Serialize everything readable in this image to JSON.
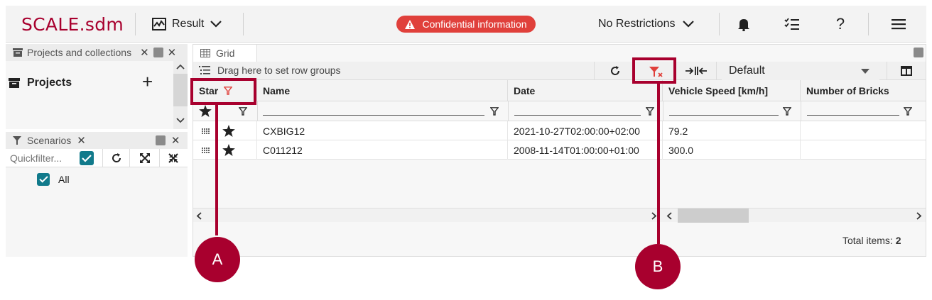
{
  "header": {
    "logo": "SCALE.sdm",
    "result_label": "Result",
    "confidential_label": "Confidential information",
    "restrictions_label": "No Restrictions"
  },
  "projects_panel": {
    "title": "Projects and collections",
    "heading": "Projects"
  },
  "scenarios_panel": {
    "title": "Scenarios",
    "quickfilter_placeholder": "Quickfilter...",
    "all_label": "All"
  },
  "grid": {
    "tab_label": "Grid",
    "row_group_hint": "Drag here to set row groups",
    "view_select": "Default",
    "columns": [
      "Star",
      "Name",
      "Date",
      "Vehicle Speed [km/h]",
      "Number of Bricks"
    ],
    "rows": [
      {
        "name": "CXBIG12",
        "date": "2021-10-27T02:00:00+02:00",
        "speed": "79.2",
        "bricks": ""
      },
      {
        "name": "C011212",
        "date": "2008-11-14T01:00:00+01:00",
        "speed": "300.0",
        "bricks": ""
      }
    ],
    "total_label": "Total items:",
    "total_count": "2"
  },
  "annotations": {
    "a": "A",
    "b": "B"
  },
  "colors": {
    "brand": "#a8002e",
    "confidential": "#e0403b",
    "checkbox": "#117a8b"
  }
}
